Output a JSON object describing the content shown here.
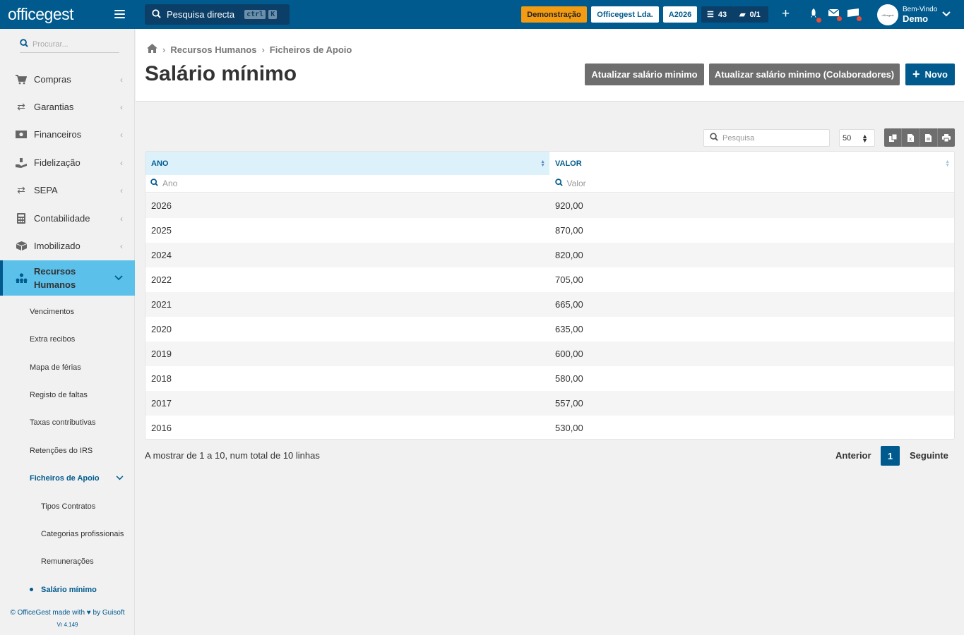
{
  "topbar": {
    "logo": "officegest",
    "search_label": "Pesquisa directa",
    "shortcut_keys": [
      "ctrl",
      "K"
    ],
    "demo_badge": "Demonstração",
    "company": "Officegest Lda.",
    "year": "A2026",
    "tasks_count": "43",
    "docs_count": "0/1",
    "welcome": "Bem-Vindo",
    "user": "Demo"
  },
  "sidebar": {
    "search_placeholder": "Procurar...",
    "items": [
      {
        "label": "Compras",
        "icon": "cart-icon"
      },
      {
        "label": "Garantias",
        "icon": "exchange-icon"
      },
      {
        "label": "Financeiros",
        "icon": "money-icon"
      },
      {
        "label": "Fidelização",
        "icon": "hand-holding-icon"
      },
      {
        "label": "SEPA",
        "icon": "exchange-icon"
      },
      {
        "label": "Contabilidade",
        "icon": "calculator-icon"
      },
      {
        "label": "Imobilizado",
        "icon": "boxes-icon"
      }
    ],
    "active": {
      "line1": "Recursos",
      "line2": "Humanos",
      "icon": "sitemap-icon"
    },
    "subitems": [
      "Vencimentos",
      "Extra recibos",
      "Mapa de férias",
      "Registo de faltas",
      "Taxas contributivas",
      "Retenções do IRS"
    ],
    "support_files": "Ficheiros de Apoio",
    "support_subitems": [
      "Tipos Contratos",
      "Categorias profissionais",
      "Remunerações"
    ],
    "active_subitem": "Salário mínimo",
    "footer_prefix": "© OfficeGest made with",
    "footer_suffix": "by Guisoft",
    "version": "Vr 4.149"
  },
  "header": {
    "breadcrumb": [
      "Recursos Humanos",
      "Ficheiros de Apoio"
    ],
    "title": "Salário mínimo",
    "btn_update": "Atualizar salário minimo",
    "btn_update_collab": "Atualizar salário minimo (Colaboradores)",
    "btn_new": "Novo"
  },
  "table": {
    "search_placeholder": "Pesquisa",
    "page_size": "50",
    "columns": [
      "ANO",
      "VALOR"
    ],
    "filters": [
      "Ano",
      "Valor"
    ],
    "rows": [
      [
        "2026",
        "920,00"
      ],
      [
        "2025",
        "870,00"
      ],
      [
        "2024",
        "820,00"
      ],
      [
        "2022",
        "705,00"
      ],
      [
        "2021",
        "665,00"
      ],
      [
        "2020",
        "635,00"
      ],
      [
        "2019",
        "600,00"
      ],
      [
        "2018",
        "580,00"
      ],
      [
        "2017",
        "557,00"
      ],
      [
        "2016",
        "530,00"
      ]
    ]
  },
  "pager": {
    "info": "A mostrar de 1 a 10, num total de 10 linhas",
    "prev": "Anterior",
    "page": "1",
    "next": "Seguinte"
  },
  "colors": {
    "brand": "#005a8e",
    "active_menu": "#5bc0ea",
    "demo_badge": "#f39c12",
    "gray_button": "#6e6e6e"
  }
}
